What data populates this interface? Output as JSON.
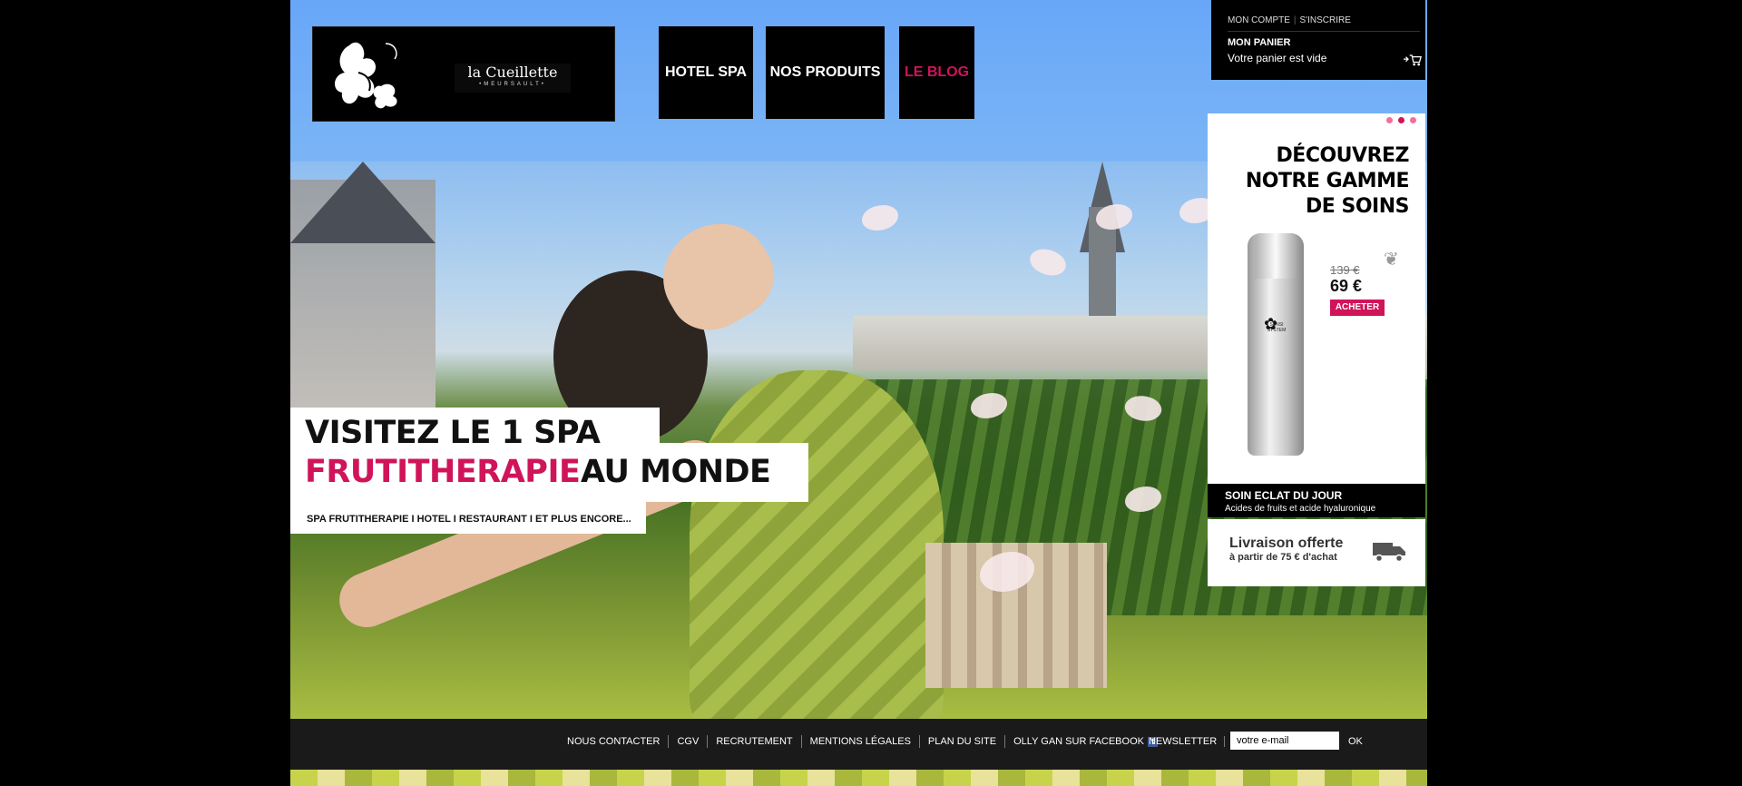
{
  "brand": {
    "name": "la Cueillette",
    "subtitle": "•MEURSAULT•"
  },
  "nav": [
    {
      "label": "HOTEL SPA"
    },
    {
      "label": "NOS PRODUITS"
    },
    {
      "label": "LE BLOG"
    }
  ],
  "account": {
    "my_account": "MON COMPTE",
    "signup": "S'INSCRIRE",
    "cart_title": "MON PANIER",
    "cart_status": "Votre panier est vide"
  },
  "promo": {
    "title_lines": [
      "DÉCOUVREZ",
      "NOTRE GAMME",
      "DE SOINS"
    ],
    "bottle_label": "SENSI SYSTEM",
    "old_price": "139 €",
    "new_price": "69 €",
    "buy_label": "ACHETER",
    "product_name": "SOIN ECLAT DU JOUR",
    "product_desc": "Acides de fruits et acide hyaluronique",
    "dots": 3,
    "active_dot": 1
  },
  "shipping": {
    "title": "Livraison offerte",
    "subtitle": "à partir de 75 € d'achat"
  },
  "headline": {
    "line1": "VISITEZ LE 1  SPA",
    "line2_pink": "FRUTITHERAPIE",
    "line2_black": "AU MONDE",
    "line3": "SPA FRUTITHERAPIE   I  HOTEL   I   RESTAURANT    I    ET PLUS ENCORE..."
  },
  "footer": {
    "links": [
      "NOUS CONTACTER",
      "CGV",
      "RECRUTEMENT",
      "MENTIONS LÉGALES",
      "PLAN DU SITE"
    ],
    "facebook_label": "OLLY GAN SUR FACEBOOK",
    "newsletter_label": "NEWSLETTER",
    "newsletter_value": "votre e-mail",
    "ok_label": "OK"
  },
  "colors": {
    "accent": "#d0145a",
    "sky": "#68a6f8",
    "footer": "#1a1a1a"
  }
}
